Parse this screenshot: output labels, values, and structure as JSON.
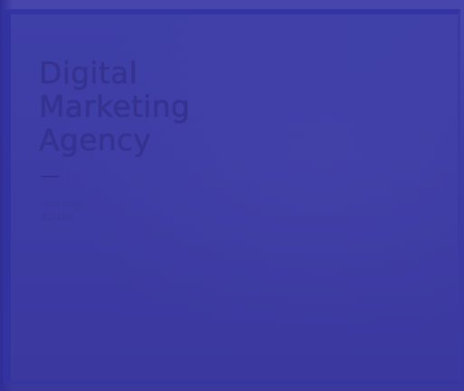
{
  "slide": {
    "title_lines": [
      "Digital",
      "Marketing",
      "Agency"
    ],
    "subtitle_lines": [
      "미디어 마케팅",
      "광고대행사"
    ]
  },
  "colors": {
    "background": "#3c3a9f",
    "text": "#35338f"
  }
}
